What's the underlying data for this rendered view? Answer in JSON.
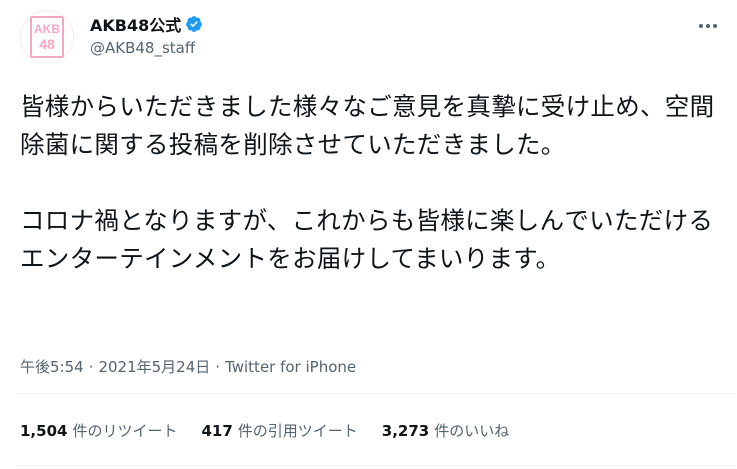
{
  "user": {
    "display_name": "AKB48公式",
    "handle": "@AKB48_staff",
    "avatar_logo": "AKB48"
  },
  "tweet": {
    "text": "皆様からいただきました様々なご意見を真摯に受け止め、空間除菌に関する投稿を削除させていただきました。\n\nコロナ禍となりますが、これからも皆様に楽しんでいただけるエンターテインメントをお届けしてまいります。",
    "time": "午後5:54",
    "separator": "·",
    "date": "2021年5月24日",
    "source": "Twitter for iPhone"
  },
  "stats": {
    "retweets_count": "1,504",
    "retweets_label": "件のリツイート",
    "quotes_count": "417",
    "quotes_label": "件の引用ツイート",
    "likes_count": "3,273",
    "likes_label": "件のいいね"
  },
  "colors": {
    "text": "#0f1419",
    "muted": "#536471",
    "verified": "#1d9bf0",
    "avatar_pink": "#f4a7c0"
  },
  "icons": {
    "verified": "verified-badge-icon",
    "more": "more-horizontal-icon"
  }
}
